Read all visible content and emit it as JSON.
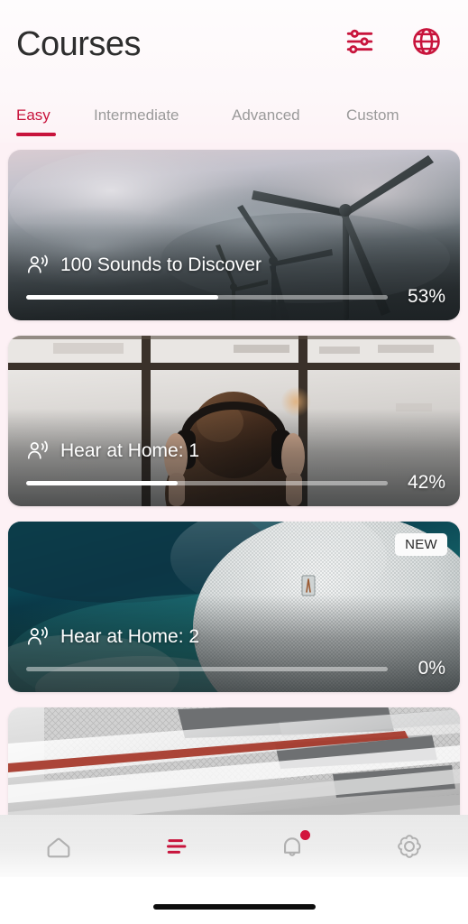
{
  "header": {
    "title": "Courses",
    "actions": [
      {
        "name": "filter-icon",
        "label": "Filter"
      },
      {
        "name": "globe-icon",
        "label": "Language"
      }
    ],
    "accent_color": "#c8143c"
  },
  "tabs": {
    "items": [
      {
        "label": "Easy",
        "active": true
      },
      {
        "label": "Intermediate",
        "active": false
      },
      {
        "label": "Advanced",
        "active": false
      },
      {
        "label": "Custom",
        "active": false
      }
    ]
  },
  "courses": [
    {
      "title": "100 Sounds to Discover",
      "progress_label": "53%",
      "progress_value": 53,
      "badge": "",
      "image": "wind-turbines-cloudy-sky"
    },
    {
      "title": "Hear at Home: 1",
      "progress_label": "42%",
      "progress_value": 42,
      "badge": "",
      "image": "woman-with-headphones-at-window"
    },
    {
      "title": "Hear at Home: 2",
      "progress_label": "0%",
      "progress_value": 0,
      "badge": "NEW",
      "image": "teal-smart-speaker"
    },
    {
      "title": "",
      "progress_label": "",
      "progress_value": 0,
      "badge": "",
      "image": "subway-train-platform"
    }
  ],
  "bottom_nav": {
    "items": [
      {
        "name": "home",
        "icon": "home-icon",
        "active": false,
        "badge": false
      },
      {
        "name": "courses",
        "icon": "courses-list-icon",
        "active": true,
        "badge": false
      },
      {
        "name": "notifications",
        "icon": "bell-icon",
        "active": false,
        "badge": true
      },
      {
        "name": "settings",
        "icon": "gear-icon",
        "active": false,
        "badge": false
      }
    ]
  }
}
